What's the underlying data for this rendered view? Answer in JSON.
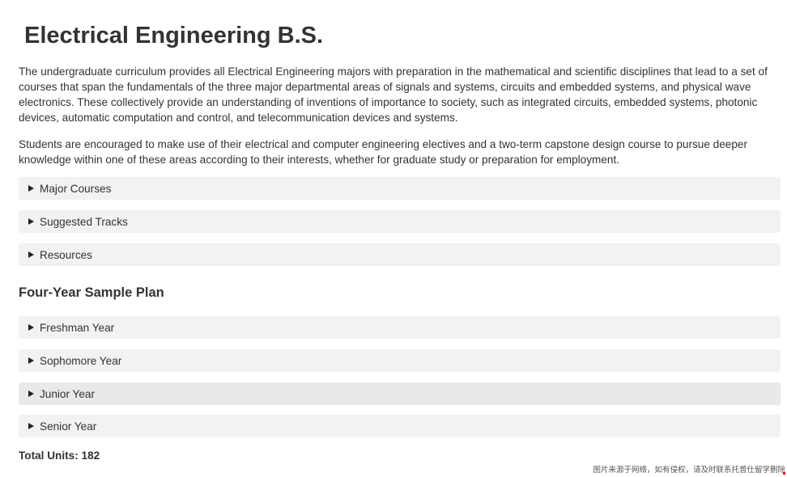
{
  "page": {
    "title": "Electrical Engineering B.S.",
    "intro_paragraphs": [
      "The undergraduate curriculum provides all Electrical Engineering majors with preparation in the mathematical and scientific disciplines that lead to a set of courses that span the fundamentals of the three major departmental areas of signals and systems, circuits and embedded systems, and physical wave electronics. These collectively provide an understanding of inventions of importance to society, such as integrated circuits, embedded systems, photonic devices, automatic computation and control, and telecommunication devices and systems.",
      "Students are encouraged to make use of their electrical and computer engineering electives and a two-term capstone design course to pursue deeper knowledge within one of these areas according to their interests, whether for graduate study or preparation for employment."
    ]
  },
  "info_sections": [
    {
      "label": "Major Courses",
      "expanded": false
    },
    {
      "label": "Suggested Tracks",
      "expanded": false
    },
    {
      "label": "Resources",
      "expanded": false
    }
  ],
  "sample_plan": {
    "heading": "Four-Year Sample Plan",
    "years": [
      {
        "label": "Freshman Year",
        "expanded": false
      },
      {
        "label": "Sophomore Year",
        "expanded": false
      },
      {
        "label": "Junior Year",
        "expanded": false
      },
      {
        "label": "Senior Year",
        "expanded": false
      }
    ],
    "total_units": "Total Units: 182"
  },
  "watermark": "图片来源于网络，如有侵权，请及时联系托普仕留学删除",
  "icons": {
    "expand": "triangle-right-icon"
  },
  "colors": {
    "accordion_bg": "#f2f2f2",
    "accordion_hover_bg": "#e9e9e9",
    "text": "#333333"
  }
}
